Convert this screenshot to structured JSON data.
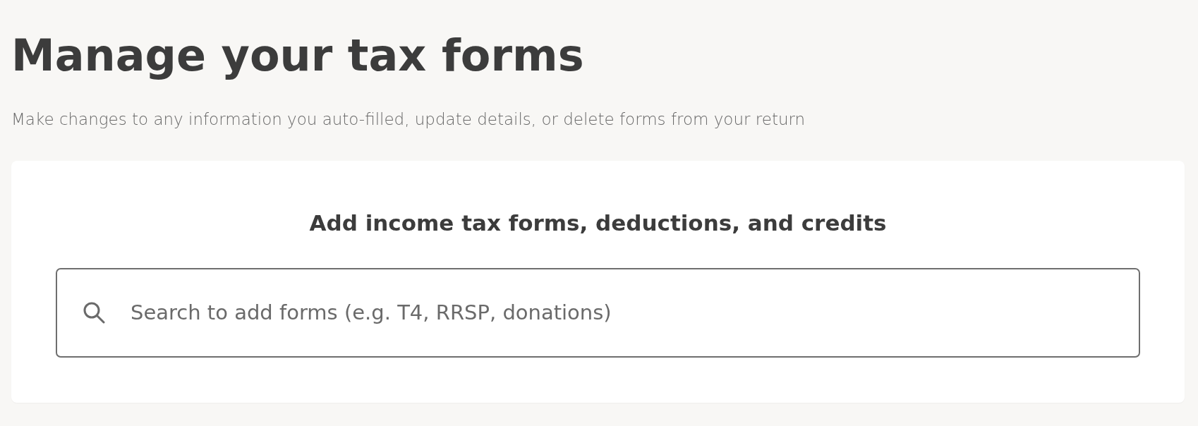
{
  "page": {
    "title": "Manage your tax forms",
    "subtitle": "Make changes to any information you auto-filled, update details, or delete forms from your return"
  },
  "card": {
    "heading": "Add income tax forms, deductions, and credits",
    "search": {
      "placeholder": "Search to add forms (e.g. T4, RRSP, donations)"
    }
  }
}
